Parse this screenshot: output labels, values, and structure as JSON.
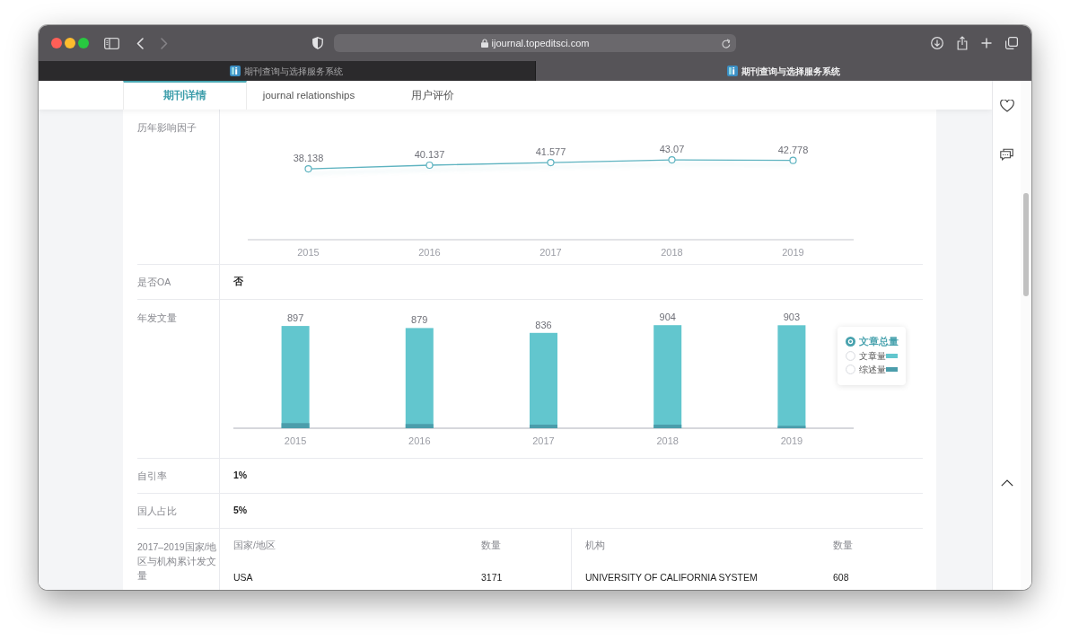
{
  "browser": {
    "url": "ijournal.topeditsci.com",
    "tabs": [
      {
        "title": "期刊查询与选择服务系统",
        "selected": false
      },
      {
        "title": "期刊查询与选择服务系统",
        "selected": true
      }
    ]
  },
  "page_tabs": [
    {
      "label": "期刊详情",
      "selected": true
    },
    {
      "label": "journal relationships",
      "selected": false
    },
    {
      "label": "用户评价",
      "selected": false
    }
  ],
  "rows": [
    {
      "kind": "chart",
      "label": "历年影响因子",
      "chart_data": [
        {
          "type": "line",
          "categories": [
            "2015",
            "2016",
            "2017",
            "2018",
            "2019"
          ],
          "values": [
            38.138,
            40.137,
            41.577,
            43.07,
            42.778
          ],
          "color": "#5eb3c0",
          "marker": "circle",
          "data_labels": true
        }
      ]
    },
    {
      "kind": "text",
      "label": "是否OA",
      "value": "否"
    },
    {
      "kind": "chart",
      "label": "年发文量",
      "chart_data": [
        {
          "type": "bar",
          "categories": [
            "2015",
            "2016",
            "2017",
            "2018",
            "2019"
          ],
          "values": [
            897,
            879,
            836,
            904,
            903
          ],
          "color": "#62c6ce",
          "data_labels": true
        }
      ],
      "legend_options": [
        {
          "label": "文章总量",
          "selected": true
        },
        {
          "label": "文章量",
          "selected": false,
          "color": "#62c6ce"
        },
        {
          "label": "综述量",
          "selected": false,
          "color": "#4b9dab"
        }
      ]
    },
    {
      "kind": "text",
      "label": "自引率",
      "value": "1%"
    },
    {
      "kind": "text",
      "label": "国人占比",
      "value": "5%"
    },
    {
      "kind": "tables",
      "label": "2017–2019国家/地区与机构累计发文量",
      "tables": [
        {
          "columns": [
            "国家/地区",
            "数量"
          ],
          "rows": [
            [
              "USA",
              "3171"
            ]
          ]
        },
        {
          "columns": [
            "机构",
            "数量"
          ],
          "rows": [
            [
              "UNIVERSITY OF CALIFORNIA SYSTEM",
              "608"
            ]
          ]
        }
      ]
    }
  ]
}
